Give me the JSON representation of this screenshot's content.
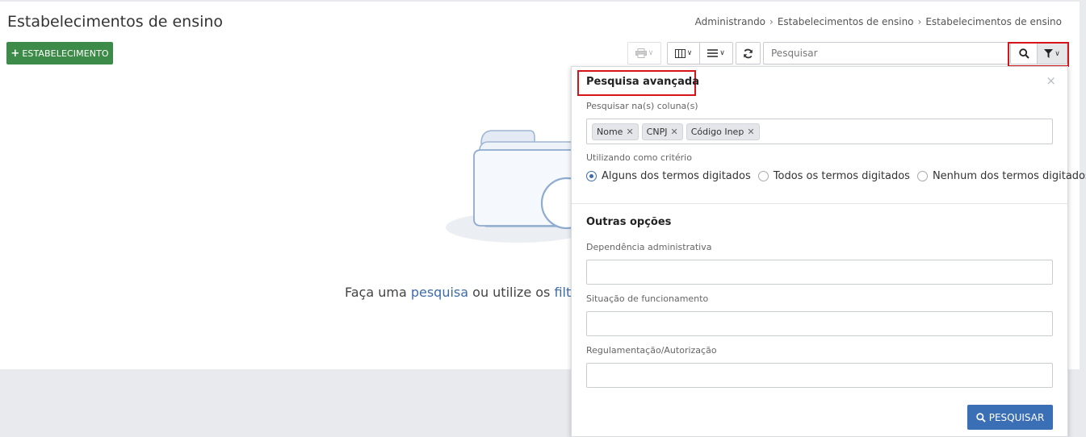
{
  "header": {
    "title": "Estabelecimentos de ensino",
    "breadcrumb": [
      "Administrando",
      "Estabelecimentos de ensino",
      "Estabelecimentos de ensino"
    ]
  },
  "toolbar": {
    "add_label": "ESTABELECIMENTO",
    "search_placeholder": "Pesquisar"
  },
  "empty_state": {
    "text_before": "Faça uma ",
    "link1": "pesquisa",
    "text_middle": " ou utilize os ",
    "link2": "filtros"
  },
  "advanced_search": {
    "title": "Pesquisa avançada",
    "columns_label": "Pesquisar na(s) coluna(s)",
    "columns": [
      {
        "label": "Nome"
      },
      {
        "label": "CNPJ"
      },
      {
        "label": "Código Inep"
      }
    ],
    "criteria_label": "Utilizando como critério",
    "criteria": [
      {
        "label": "Alguns dos termos digitados",
        "selected": true
      },
      {
        "label": "Todos os termos digitados",
        "selected": false
      },
      {
        "label": "Nenhum dos termos digitados",
        "selected": false
      }
    ],
    "other_options_title": "Outras opções",
    "fields": [
      {
        "label": "Dependência administrativa",
        "value": ""
      },
      {
        "label": "Situação de funcionamento",
        "value": ""
      },
      {
        "label": "Regulamentação/Autorização",
        "value": ""
      }
    ],
    "submit_label": "PESQUISAR"
  },
  "colors": {
    "accent_green": "#3d8b48",
    "accent_blue": "#3a6eb5",
    "highlight_red": "#d7141a"
  }
}
